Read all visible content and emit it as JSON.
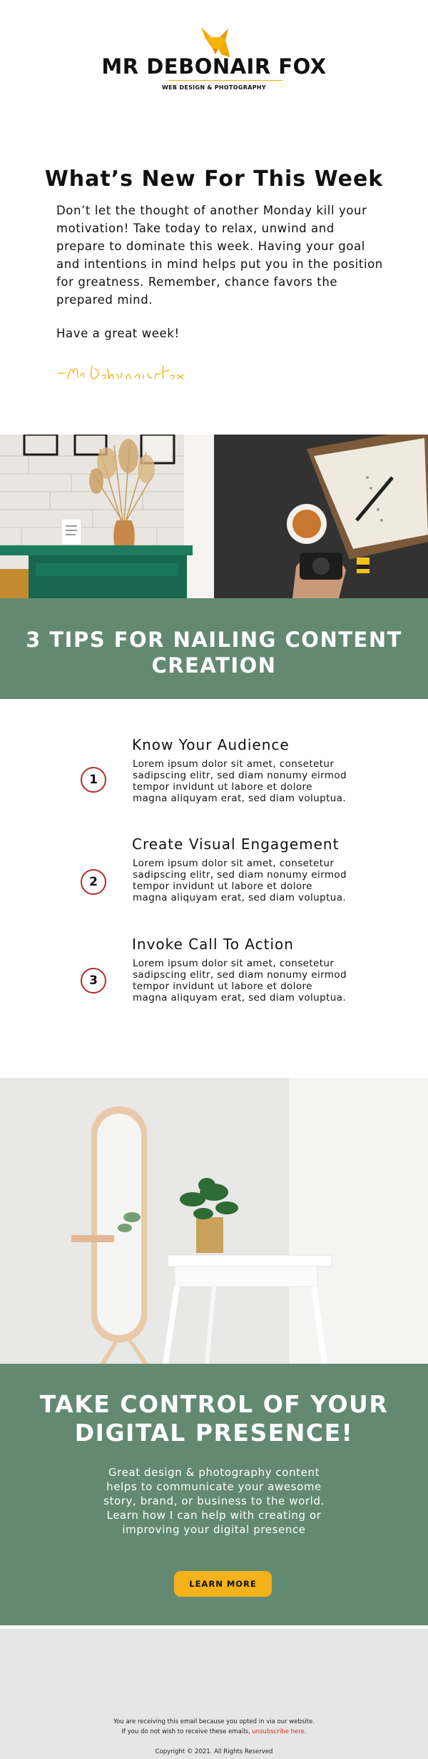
{
  "header": {
    "brand": "MR DEBONAIR FOX",
    "tagline": "WEB DESIGN & PHOTOGRAPHY",
    "logo_icon": "fox-icon",
    "accent_color": "#f2a900"
  },
  "intro": {
    "title": "What’s New For This Week",
    "body": "Don’t let the thought of another Monday kill your motivation! Take today to relax, unwind and prepare to dominate this week. Having your goal and intentions in mind helps put you in the position for greatness. Remember, chance favors the prepared mind.",
    "signoff": "Have a great week!",
    "signature": "- Mr Debonair Fox"
  },
  "photos": {
    "left": "vase-on-green-dresser-photo",
    "right": "camera-notebook-coffee-photo",
    "lower": "mirror-and-plant-photo"
  },
  "tips": {
    "banner_color": "#638a70",
    "title": "3 TIPS FOR NAILING CONTENT CREATION",
    "items": [
      {
        "number": "1",
        "heading": "Know Your Audience",
        "text": "Lorem ipsum dolor sit amet, consetetur sadipscing elitr, sed diam nonumy eirmod tempor invidunt ut labore et dolore magna aliquyam erat, sed diam voluptua."
      },
      {
        "number": "2",
        "heading": "Create Visual Engagement",
        "text": "Lorem ipsum dolor sit amet, consetetur sadipscing elitr, sed diam nonumy eirmod tempor invidunt ut labore et dolore magna aliquyam erat, sed diam voluptua."
      },
      {
        "number": "3",
        "heading": "Invoke Call To Action",
        "text": "Lorem ipsum dolor sit amet, consetetur sadipscing elitr, sed diam nonumy eirmod tempor invidunt ut labore et dolore magna aliquyam erat, sed diam voluptua."
      }
    ]
  },
  "cta": {
    "title": "TAKE CONTROL OF YOUR DIGITAL PRESENCE!",
    "text": "Great design & photography content helps to communicate your awesome story, brand, or business to the world. Learn how I can help with creating or improving your digital presence",
    "button_label": "LEARN MORE",
    "button_color": "#f4b21b"
  },
  "footer": {
    "line1": "You are receiving this email because you opted in via our website.",
    "line2_prefix": "If you do not wish to receive these emails, ",
    "unsubscribe_label": "unsubscribe here.",
    "copyright": "Copyright © 2021. All Rights Reserved"
  }
}
